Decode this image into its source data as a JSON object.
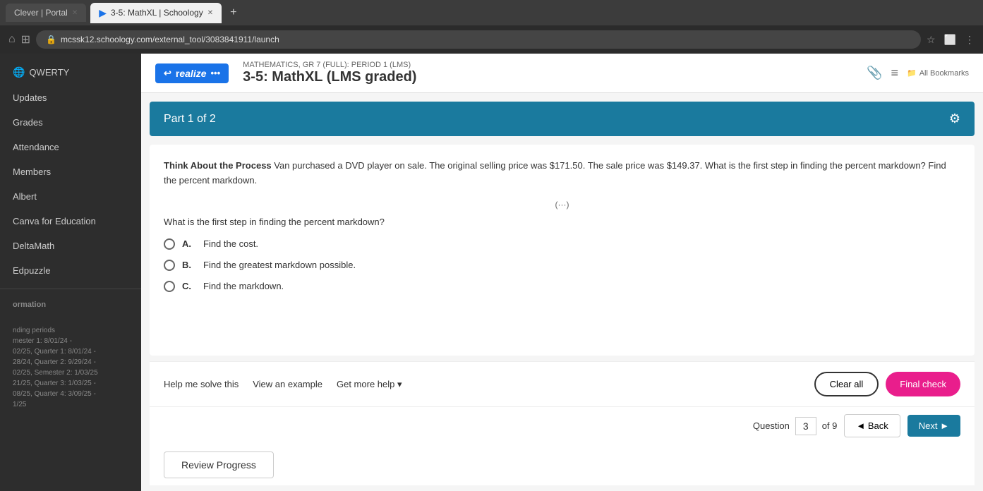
{
  "browser": {
    "tabs": [
      {
        "id": "clever",
        "label": "Clever | Portal",
        "active": false
      },
      {
        "id": "mathxl",
        "label": "3-5: MathXL | Schoology",
        "active": true
      }
    ],
    "tab_add": "+",
    "url": "mcssk12.schoology.com/external_tool/3083841911/launch",
    "bookmarks_label": "All Bookmarks"
  },
  "sidebar": {
    "items": [
      {
        "id": "updates",
        "label": "Updates"
      },
      {
        "id": "grades",
        "label": "Grades"
      },
      {
        "id": "attendance",
        "label": "Attendance"
      },
      {
        "id": "members",
        "label": "Members"
      },
      {
        "id": "albert",
        "label": "Albert"
      },
      {
        "id": "canva",
        "label": "Canva for Education"
      },
      {
        "id": "deltamath",
        "label": "DeltaMath"
      },
      {
        "id": "edpuzzle",
        "label": "Edpuzzle"
      }
    ],
    "section_label": "ormation",
    "period_info": "nding periods\nmester 1: 8/01/24 -\n02/25, Quarter 1: 8/01/24 -\n28/24, Quarter 2: 9/29/24 -\n02/25, Semester 2: 1/03/25\n21/25, Quarter 3: 1/03/25 -\n08/25, Quarter 4: 3/09/25 -\n1/25",
    "qwerty_label": "QWERTY"
  },
  "content": {
    "logo_icon": "↩",
    "logo_text": "realize",
    "logo_dots": "•••",
    "course_subtitle": "MATHEMATICS, GR 7 (FULL): PERIOD 1 (LMS)",
    "course_title": "3-5: MathXL (LMS graded)",
    "bookmarks_label": "All Bookmarks",
    "part_header": "Part 1 of 2",
    "settings_icon": "⚙",
    "question_intro": "Think About the Process",
    "question_body": " Van purchased a DVD player on sale. The original selling price was $171.50. The sale price was $149.37. What is the first step in finding the percent markdown? Find the percent markdown.",
    "dots": "(···)",
    "sub_question": "What is the first step in finding the percent markdown?",
    "options": [
      {
        "id": "A",
        "label": "A.",
        "text": "Find the cost."
      },
      {
        "id": "B",
        "label": "B.",
        "text": "Find the greatest markdown possible."
      },
      {
        "id": "C",
        "label": "C.",
        "text": "Find the markdown."
      }
    ],
    "help_label": "Help me solve this",
    "example_label": "View an example",
    "more_help_label": "Get more help ▾",
    "clear_all_label": "Clear all",
    "final_check_label": "Final check",
    "question_label": "Question",
    "question_number": "3",
    "of_label": "of 9",
    "back_label": "◄ Back",
    "next_label": "Next ►",
    "review_label": "Review Progress"
  }
}
